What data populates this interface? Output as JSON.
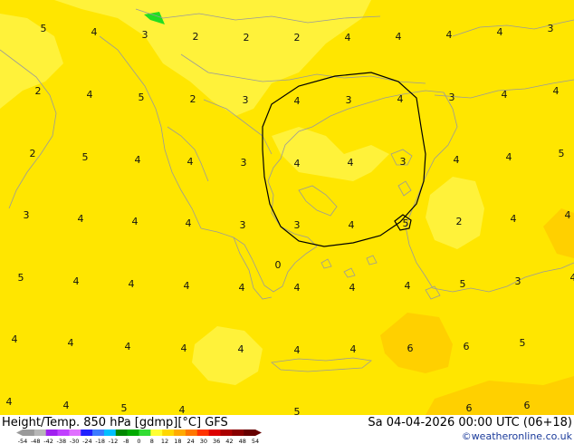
{
  "footer": {
    "left_label": "Height/Temp. 850 hPa [gdmp][°C] GFS",
    "right_label": "Sa 04-04-2026 00:00 UTC (06+18)",
    "credit": "©weatheronline.co.uk"
  },
  "colorbar": {
    "ticks": [
      "-54",
      "-48",
      "-42",
      "-38",
      "-30",
      "-24",
      "-18",
      "-12",
      "-8",
      "0",
      "8",
      "12",
      "18",
      "24",
      "30",
      "36",
      "42",
      "48",
      "54"
    ],
    "colors": [
      "#9a9a9a",
      "#b7b7b7",
      "#a020f0",
      "#c040ff",
      "#e070ff",
      "#2020ff",
      "#3c7bff",
      "#00c0ff",
      "#008800",
      "#00aa00",
      "#33dd33",
      "#ffff33",
      "#ffd700",
      "#ffaa00",
      "#ff7700",
      "#ff3300",
      "#dd0000",
      "#aa0000",
      "#880000",
      "#660000"
    ]
  },
  "map_colors": {
    "base": "#ffe600",
    "light": "#fff23a",
    "warm": "#ffd000",
    "green": "#22dd22",
    "outline": "#9a9a9a",
    "contour": "#000000"
  },
  "values": [
    [
      "5",
      48,
      35
    ],
    [
      "4",
      104,
      39
    ],
    [
      "3",
      160,
      42
    ],
    [
      "2",
      216,
      44
    ],
    [
      "2",
      272,
      45
    ],
    [
      "2",
      328,
      45
    ],
    [
      "4",
      384,
      45
    ],
    [
      "4",
      440,
      44
    ],
    [
      "4",
      496,
      42
    ],
    [
      "4",
      552,
      39
    ],
    [
      "3",
      608,
      35
    ],
    [
      "2",
      42,
      104
    ],
    [
      "4",
      99,
      108
    ],
    [
      "5",
      156,
      111
    ],
    [
      "2",
      213,
      113
    ],
    [
      "3",
      271,
      114
    ],
    [
      "4",
      328,
      115
    ],
    [
      "3",
      385,
      114
    ],
    [
      "4",
      442,
      113
    ],
    [
      "3",
      499,
      111
    ],
    [
      "4",
      557,
      108
    ],
    [
      "4",
      614,
      104
    ],
    [
      "2",
      36,
      173
    ],
    [
      "5",
      94,
      177
    ],
    [
      "4",
      152,
      180
    ],
    [
      "4",
      210,
      182
    ],
    [
      "3",
      269,
      183
    ],
    [
      "4",
      328,
      184
    ],
    [
      "4",
      387,
      183
    ],
    [
      "3",
      445,
      182
    ],
    [
      "4",
      504,
      180
    ],
    [
      "4",
      562,
      177
    ],
    [
      "5",
      620,
      173
    ],
    [
      "3",
      29,
      241
    ],
    [
      "4",
      89,
      245
    ],
    [
      "4",
      149,
      248
    ],
    [
      "4",
      208,
      250
    ],
    [
      "3",
      268,
      252
    ],
    [
      "3",
      328,
      252
    ],
    [
      "4",
      388,
      252
    ],
    [
      "5",
      448,
      250
    ],
    [
      "2",
      507,
      248
    ],
    [
      "4",
      567,
      245
    ],
    [
      "4",
      627,
      241
    ],
    [
      "5",
      23,
      310
    ],
    [
      "4",
      84,
      314
    ],
    [
      "4",
      145,
      317
    ],
    [
      "4",
      206,
      319
    ],
    [
      "4",
      267,
      321
    ],
    [
      "4",
      328,
      321
    ],
    [
      "4",
      389,
      321
    ],
    [
      "4",
      450,
      319
    ],
    [
      "5",
      511,
      317
    ],
    [
      "3",
      572,
      314
    ],
    [
      "4",
      633,
      310
    ],
    [
      "4",
      16,
      378
    ],
    [
      "4",
      78,
      382
    ],
    [
      "4",
      141,
      386
    ],
    [
      "4",
      203,
      388
    ],
    [
      "4",
      266,
      389
    ],
    [
      "4",
      328,
      390
    ],
    [
      "4",
      390,
      389
    ],
    [
      "6",
      453,
      388
    ],
    [
      "6",
      515,
      386
    ],
    [
      "5",
      577,
      382
    ],
    [
      "4",
      10,
      447
    ],
    [
      "4",
      73,
      451
    ],
    [
      "5",
      137,
      454
    ],
    [
      "4",
      201,
      456
    ],
    [
      "5",
      328,
      458
    ],
    [
      "6",
      518,
      454
    ],
    [
      "6",
      582,
      451
    ],
    [
      "0",
      307,
      296
    ]
  ]
}
